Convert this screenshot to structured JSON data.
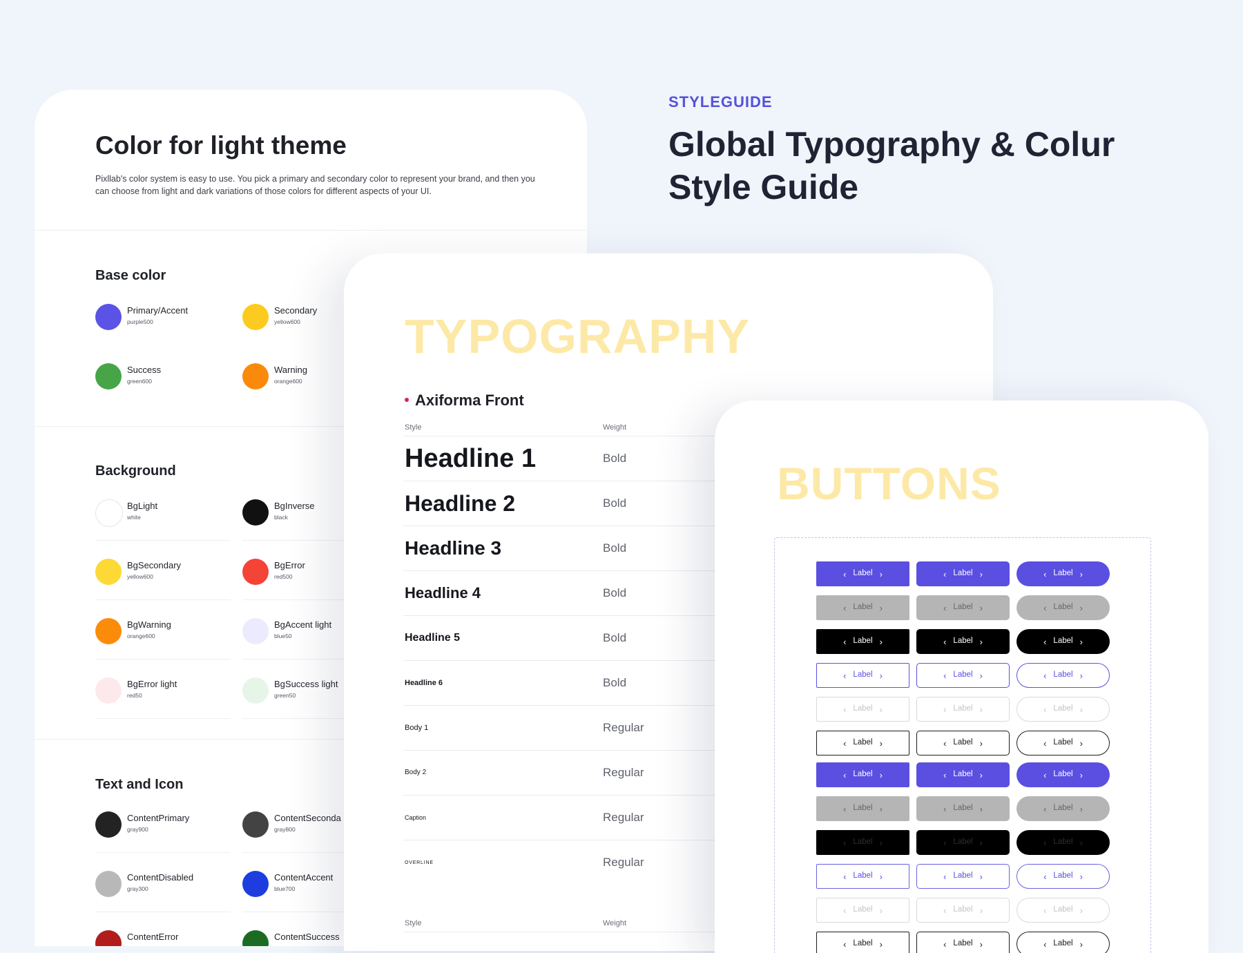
{
  "color_card": {
    "title": "Color for light theme",
    "description": "Pixllab's color system is easy to use. You pick a primary and secondary color to represent your brand, and then you can choose from light and dark variations of those colors for different aspects of your UI.",
    "sections": [
      {
        "title": "Base color",
        "swatches": [
          {
            "name": "Primary/Accent",
            "token": "purple500",
            "color": "#5b52e6"
          },
          {
            "name": "Secondary",
            "token": "yellow600",
            "color": "#fdca1f"
          },
          {
            "name": "Success",
            "token": "green600",
            "color": "#47a548"
          },
          {
            "name": "Warning",
            "token": "orange600",
            "color": "#fb8a0c"
          }
        ]
      },
      {
        "title": "Background",
        "swatches": [
          {
            "name": "BgLight",
            "token": "white",
            "color": "#ffffff"
          },
          {
            "name": "BgInverse",
            "token": "black",
            "color": "#111111"
          },
          {
            "name": "BgSecondary",
            "token": "yellow600",
            "color": "#fdd936"
          },
          {
            "name": "BgError",
            "token": "red500",
            "color": "#f44337"
          },
          {
            "name": "BgWarning",
            "token": "orange600",
            "color": "#fb8c0a"
          },
          {
            "name": "BgAccent light",
            "token": "blue50",
            "color": "#ecebfd"
          },
          {
            "name": "BgError light",
            "token": "red50",
            "color": "#fde9ec"
          },
          {
            "name": "BgSuccess light",
            "token": "green50",
            "color": "#e7f5e9"
          }
        ]
      },
      {
        "title": "Text and Icon",
        "swatches": [
          {
            "name": "ContentPrimary",
            "token": "gray900",
            "color": "#232323"
          },
          {
            "name": "ContentSeconda",
            "token": "gray800",
            "color": "#434343"
          },
          {
            "name": "ContentDisabled",
            "token": "gray300",
            "color": "#b8b8b8"
          },
          {
            "name": "ContentAccent",
            "token": "blue700",
            "color": "#1e3ddf"
          },
          {
            "name": "ContentError",
            "token": "",
            "color": "#b21c1c"
          },
          {
            "name": "ContentSuccess",
            "token": "",
            "color": "#1b6c22"
          }
        ]
      }
    ]
  },
  "header": {
    "eyebrow": "STYLEGUIDE",
    "headline": "Global Typography & Colur Style Guide"
  },
  "typography": {
    "title": "TYPOGRAPHY",
    "font_name": "Axiforma Front",
    "col_style": "Style",
    "col_weight": "Weight",
    "rows": [
      {
        "style": "Headline 1",
        "weight": "Bold"
      },
      {
        "style": "Headline 2",
        "weight": "Bold"
      },
      {
        "style": "Headline 3",
        "weight": "Bold"
      },
      {
        "style": "Headline 4",
        "weight": "Bold"
      },
      {
        "style": "Headline 5",
        "weight": "Bold"
      },
      {
        "style": "Headline 6",
        "weight": "Bold"
      },
      {
        "style": "Body 1",
        "weight": "Regular"
      },
      {
        "style": "Body 2",
        "weight": "Regular"
      },
      {
        "style": "Caption",
        "weight": "Regular"
      },
      {
        "style": "OVERLINE",
        "weight": "Regular"
      }
    ],
    "footer_col_style": "Style",
    "footer_col_weight": "Weight"
  },
  "buttons": {
    "title": "BUTTONS",
    "label": "Label",
    "rows": [
      "primary",
      "gray",
      "dark",
      "outline-accent",
      "outline-disabled",
      "outline-dark",
      "primary",
      "gray",
      "dark-faint",
      "outline-accent2",
      "outline-disabled",
      "outline-dark"
    ],
    "shapes": [
      "square",
      "soft",
      "pill"
    ]
  }
}
